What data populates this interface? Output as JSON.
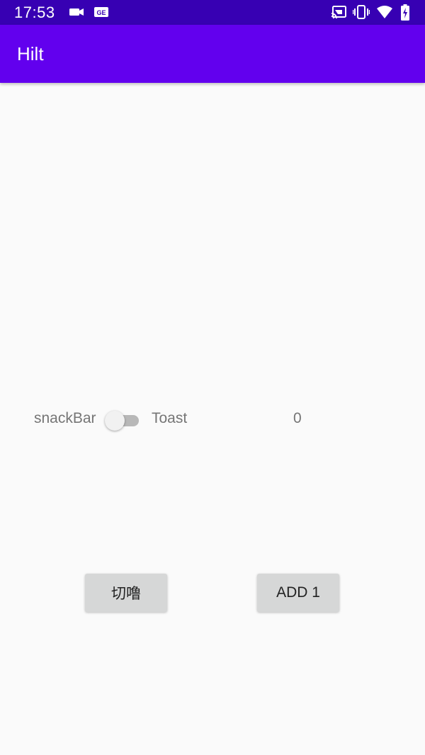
{
  "status_bar": {
    "time": "17:53",
    "left_icons": [
      "camera-notification-icon",
      "sim-card-notification-icon"
    ],
    "right_icons": [
      "cast-icon",
      "vibrate-icon",
      "wifi-icon",
      "battery-charging-icon"
    ]
  },
  "app_bar": {
    "title": "Hilt"
  },
  "main": {
    "switch_left_label": "snackBar",
    "switch_right_label": "Toast",
    "switch_checked": false,
    "counter_value": "0",
    "buttons": {
      "switch_label": "切噜",
      "add_label": "ADD 1"
    }
  },
  "colors": {
    "status_bar_bg": "#3700b3",
    "app_bar_bg": "#6200ee",
    "background": "#fafafa",
    "button_bg": "#d6d7d7"
  }
}
